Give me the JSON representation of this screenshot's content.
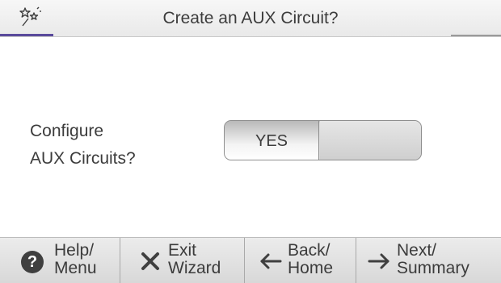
{
  "header": {
    "icon": "wizard-wand-icon",
    "title": "Create an AUX Circuit?",
    "accent_color": "#5a4a9c"
  },
  "main": {
    "question_line1": "Configure",
    "question_line2": "AUX Circuits?",
    "toggle": {
      "yes_label": "YES",
      "selected": "YES"
    }
  },
  "footer": {
    "help": {
      "icon": "question-icon",
      "glyph": "?",
      "line1": "Help/",
      "line2": "Menu"
    },
    "exit": {
      "icon": "close-icon",
      "line1": "Exit",
      "line2": "Wizard"
    },
    "back": {
      "icon": "arrow-left-icon",
      "line1": "Back/",
      "line2": "Home"
    },
    "next": {
      "icon": "arrow-right-icon",
      "line1": "Next/",
      "line2": "Summary"
    }
  }
}
